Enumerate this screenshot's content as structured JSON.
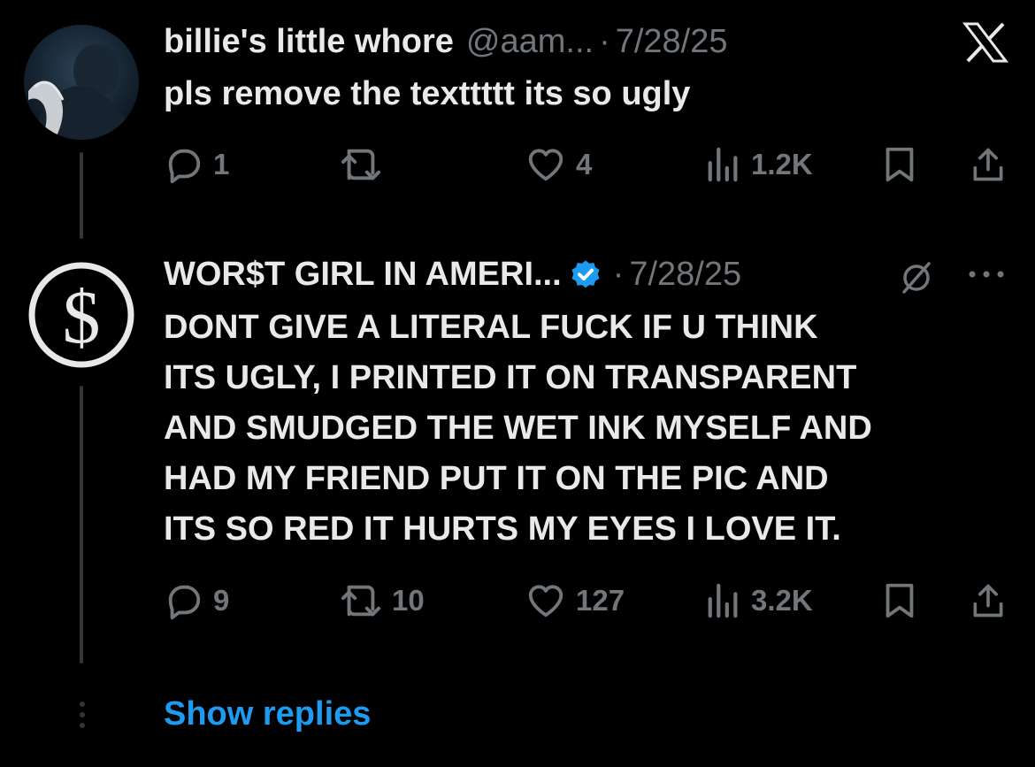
{
  "tweets": [
    {
      "name": "billie's little whore",
      "handle": "@aam...",
      "separator": "·",
      "date": "7/28/25",
      "text_lines": [
        "pls remove the texttttt its so ugly"
      ],
      "actions": {
        "replies": "1",
        "retweets": "",
        "likes": "4",
        "views": "1.2K"
      },
      "top_right_icon": "x-logo-icon"
    },
    {
      "name": "WOR$T GIRL IN AMERI...",
      "verified": true,
      "separator": "·",
      "date": "7/28/25",
      "text_lines": [
        "DONT GIVE A LITERAL FUCK IF U THINK",
        "ITS UGLY, I PRINTED IT ON TRANSPARENT",
        "AND SMUDGED THE WET INK MYSELF AND",
        "HAD MY FRIEND PUT IT ON THE PIC AND",
        "ITS SO RED IT HURTS MY EYES I LOVE IT."
      ],
      "actions": {
        "replies": "9",
        "retweets": "10",
        "likes": "127",
        "views": "3.2K"
      },
      "top_right_icons": [
        "grok-icon",
        "more-icon"
      ]
    }
  ],
  "show_replies_label": "Show replies",
  "colors": {
    "background": "#000000",
    "text": "#e7e9ea",
    "muted": "#71767b",
    "accent": "#1d9bf0"
  }
}
